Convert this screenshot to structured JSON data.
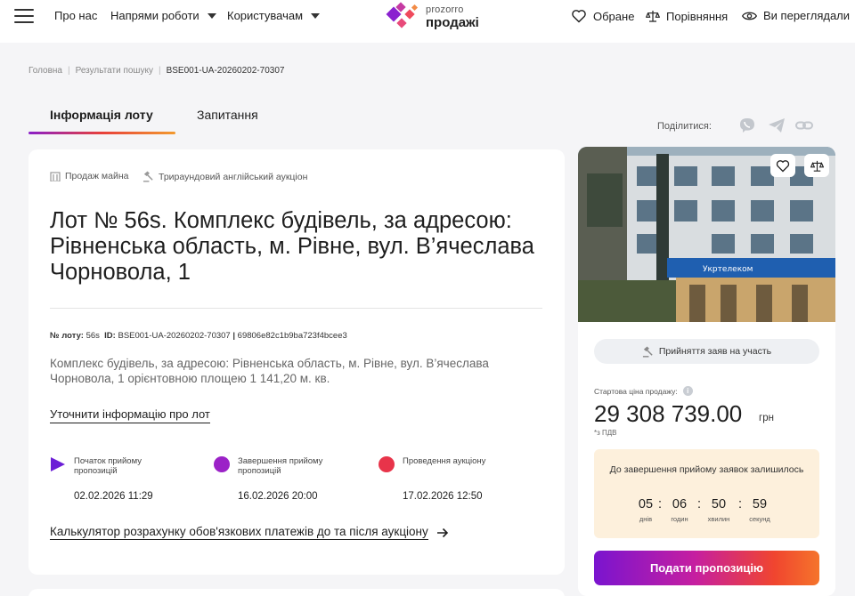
{
  "header": {
    "nav": [
      {
        "label": "Про нас"
      },
      {
        "label": "Напрями роботи"
      },
      {
        "label": "Користувачам"
      }
    ],
    "logo": {
      "top": "prozorro",
      "bottom": "продажі"
    },
    "favorites": "Обране",
    "compare": "Порівняння",
    "viewed": "Ви переглядали"
  },
  "breadcrumb": {
    "home": "Головна",
    "results": "Результати пошуку",
    "current": "BSE001-UA-20260202-70307"
  },
  "tabs": {
    "info": "Інформація лоту",
    "questions": "Запитання"
  },
  "share": {
    "label": "Поділитися:"
  },
  "lot": {
    "tag_sale": "Продаж майна",
    "tag_auction": "Трираундовий англійський аукціон",
    "title": "Лот № 56s. Комплекс будівель, за адресою: Рівненська область, м. Рівне, вул. В’ячеслава Чорновола, 1",
    "lot_no_label": "№ лоту:",
    "lot_no": "56s",
    "id_label": "ID:",
    "id": "BSE001-UA-20260202-70307",
    "sep": "|",
    "hash": "69806e82c1b9ba723f4bcee3",
    "description": "Комплекс будівель, за адресою: Рівненська область, м. Рівне, вул. В’ячеслава Чорновола, 1 орієнтовною площею 1 141,20 м. кв.",
    "clarify_link": "Уточнити інформацію про лот",
    "stages": [
      {
        "label": "Початок прийому пропозицій",
        "date": "02.02.2026  11:29",
        "color": "#6b1ed6"
      },
      {
        "label": "Завершення прийому пропозицій",
        "date": "16.02.2026  20:00",
        "color": "#9b22c7"
      },
      {
        "label": "Проведення аукціону",
        "date": "17.02.2026  12:50",
        "color": "#e8344a"
      }
    ],
    "calc_link": "Калькулятор розрахунку обов'язкових платежів до та після аукціону"
  },
  "side": {
    "accept": "Прийняття заяв на участь",
    "start_price_label": "Стартова ціна продажу:",
    "price": "29 308 739.00",
    "currency": "грн",
    "vat": "*з ПДВ",
    "timer_title": "До завершення прийому заявок залишилось",
    "timer": [
      {
        "num": "05",
        "lbl": "днів"
      },
      {
        "num": "06",
        "lbl": "годин"
      },
      {
        "num": "50",
        "lbl": "хвилин"
      },
      {
        "num": "59",
        "lbl": "секунд"
      }
    ],
    "submit": "Подати пропозицію",
    "building_sign": "Укртелеком"
  },
  "colors": {
    "accent_purple": "#7a14cf",
    "accent_orange": "#f5742b",
    "timer_bg": "#fdf0dc"
  }
}
